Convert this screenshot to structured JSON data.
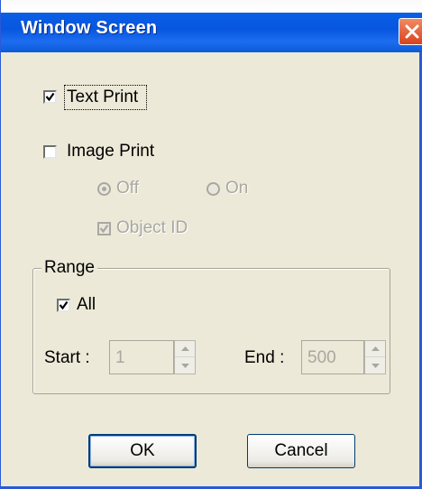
{
  "window": {
    "title": "Window Screen",
    "close_icon": "close-icon"
  },
  "text_print": {
    "label": "Text Print",
    "checked": true
  },
  "image_print": {
    "label": "Image Print",
    "checked": false,
    "off_label": "Off",
    "on_label": "On",
    "selected": "Off",
    "object_id_label": "Object ID",
    "object_id_checked": true
  },
  "range": {
    "group_label": "Range",
    "all_label": "All",
    "all_checked": true,
    "start_label": "Start :",
    "start_value": "1",
    "end_label": "End :",
    "end_value": "500"
  },
  "buttons": {
    "ok": "OK",
    "cancel": "Cancel"
  },
  "colors": {
    "titlebar": "#0a5fe5",
    "face": "#ece9d8",
    "disabled_text": "#a9a8a0",
    "close": "#e0582d"
  }
}
